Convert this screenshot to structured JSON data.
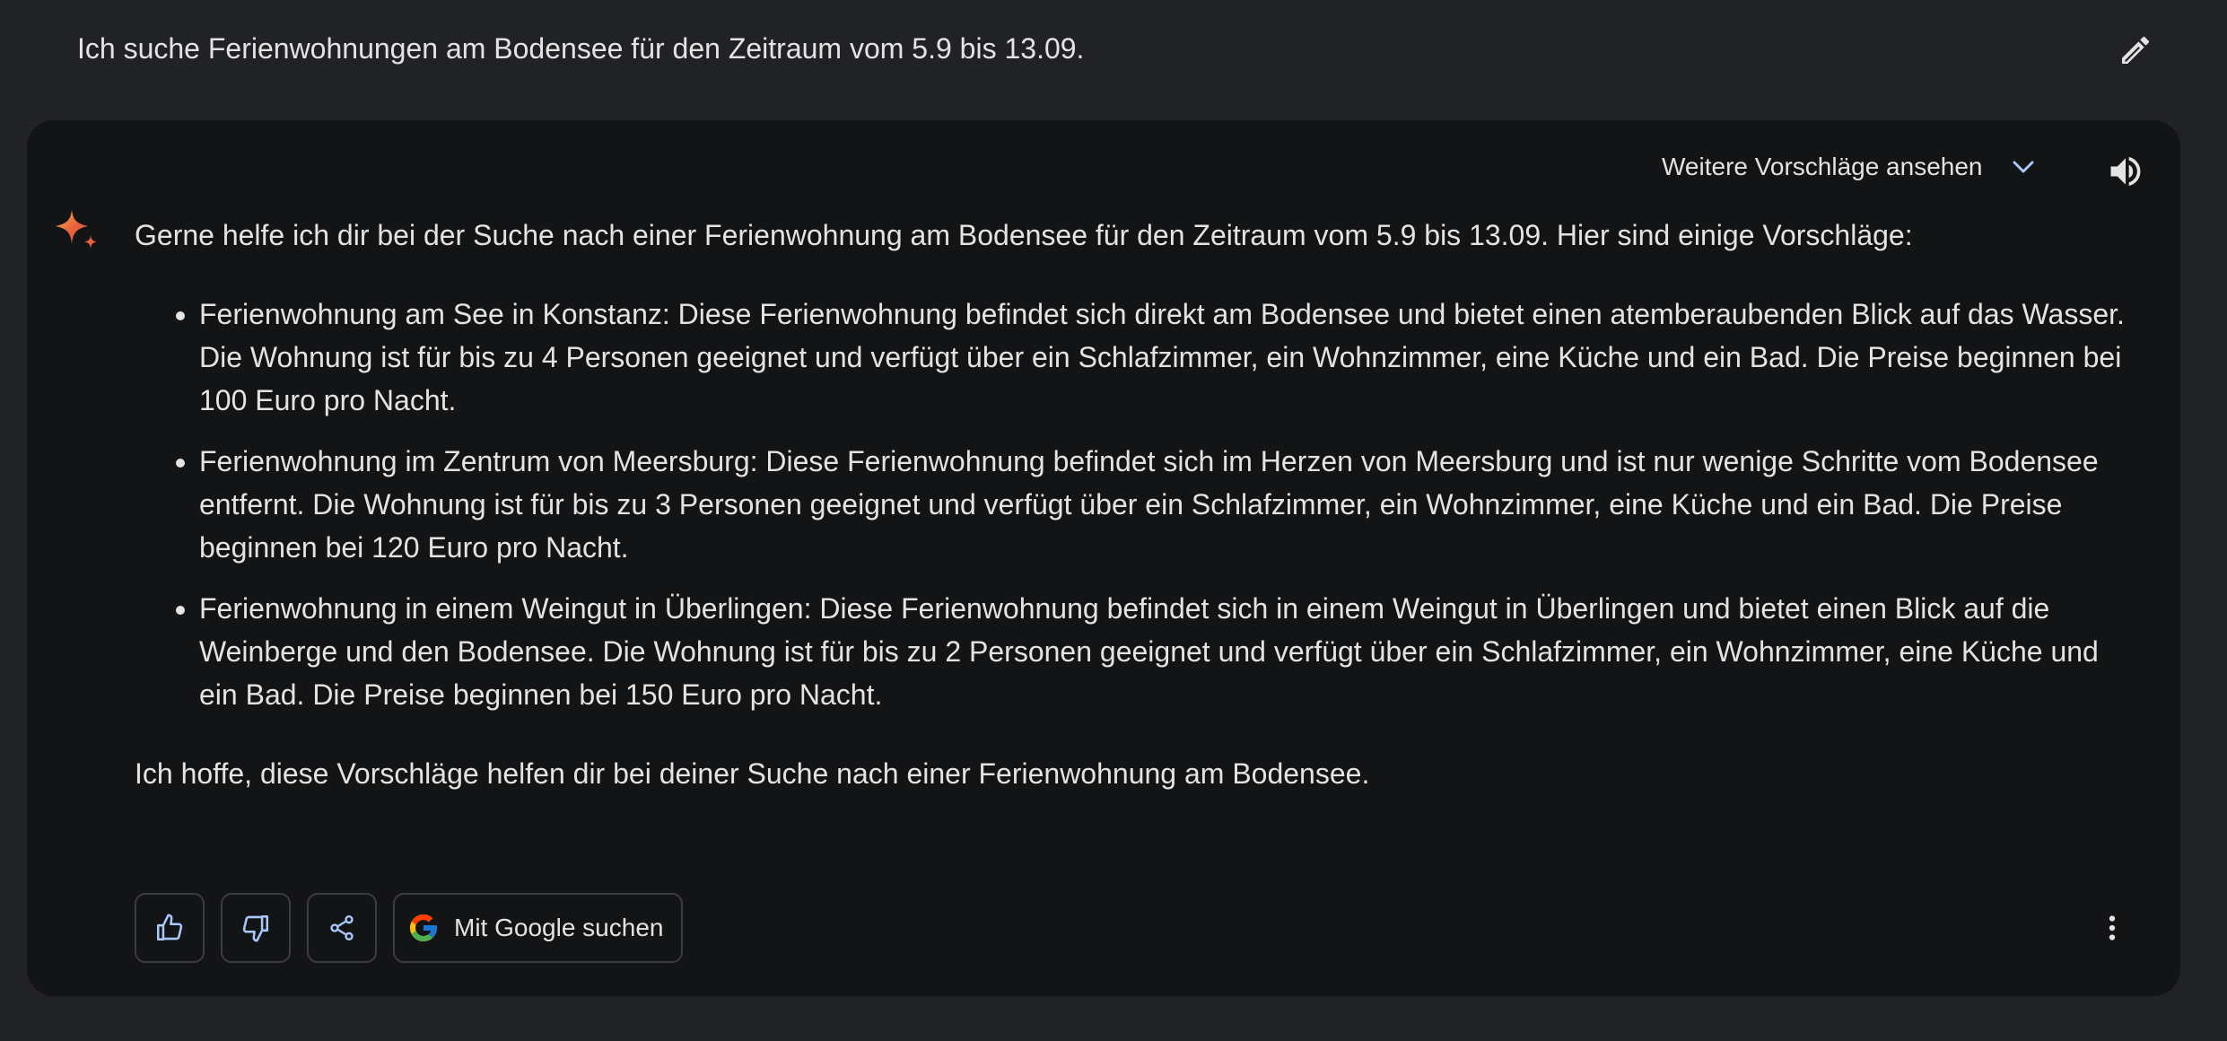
{
  "prompt": {
    "text": "Ich suche Ferienwohnungen am Bodensee für den Zeitraum vom 5.9 bis 13.09.",
    "edit_icon": "pencil-icon"
  },
  "response": {
    "drafts_label": "Weitere Vorschläge ansehen",
    "drafts_icon": "chevron-down-icon",
    "speaker_icon": "volume-icon",
    "avatar_icon": "sparkle-icon",
    "intro": "Gerne helfe ich dir bei der Suche nach einer Ferienwohnung am Bodensee für den Zeitraum vom 5.9 bis 13.09. Hier sind einige Vorschläge:",
    "items": [
      "Ferienwohnung am See in Konstanz: Diese Ferienwohnung befindet sich direkt am Bodensee und bietet einen atemberaubenden Blick auf das Wasser. Die Wohnung ist für bis zu 4 Personen geeignet und verfügt über ein Schlafzimmer, ein Wohnzimmer, eine Küche und ein Bad. Die Preise beginnen bei 100 Euro pro Nacht.",
      "Ferienwohnung im Zentrum von Meersburg: Diese Ferienwohnung befindet sich im Herzen von Meersburg und ist nur wenige Schritte vom Bodensee entfernt. Die Wohnung ist für bis zu 3 Personen geeignet und verfügt über ein Schlafzimmer, ein Wohnzimmer, eine Küche und ein Bad. Die Preise beginnen bei 120 Euro pro Nacht.",
      "Ferienwohnung in einem Weingut in Überlingen: Diese Ferienwohnung befindet sich in einem Weingut in Überlingen und bietet einen Blick auf die Weinberge und den Bodensee. Die Wohnung ist für bis zu 2 Personen geeignet und verfügt über ein Schlafzimmer, ein Wohnzimmer, eine Küche und ein Bad. Die Preise beginnen bei 150 Euro pro Nacht."
    ],
    "outro": "Ich hoffe, diese Vorschläge helfen dir bei deiner Suche nach einer Ferienwohnung am Bodensee."
  },
  "actions": {
    "thumbs_up_icon": "thumbs-up-icon",
    "thumbs_down_icon": "thumbs-down-icon",
    "share_icon": "share-icon",
    "google_icon": "google-g-icon",
    "google_label": "Mit Google suchen",
    "more_icon": "more-vert-icon"
  },
  "colors": {
    "page_bg": "#212226",
    "card_bg": "#131416",
    "text": "#e3e3e3",
    "accent_blue": "#a8c7fa",
    "button_border": "#3c3d41"
  }
}
